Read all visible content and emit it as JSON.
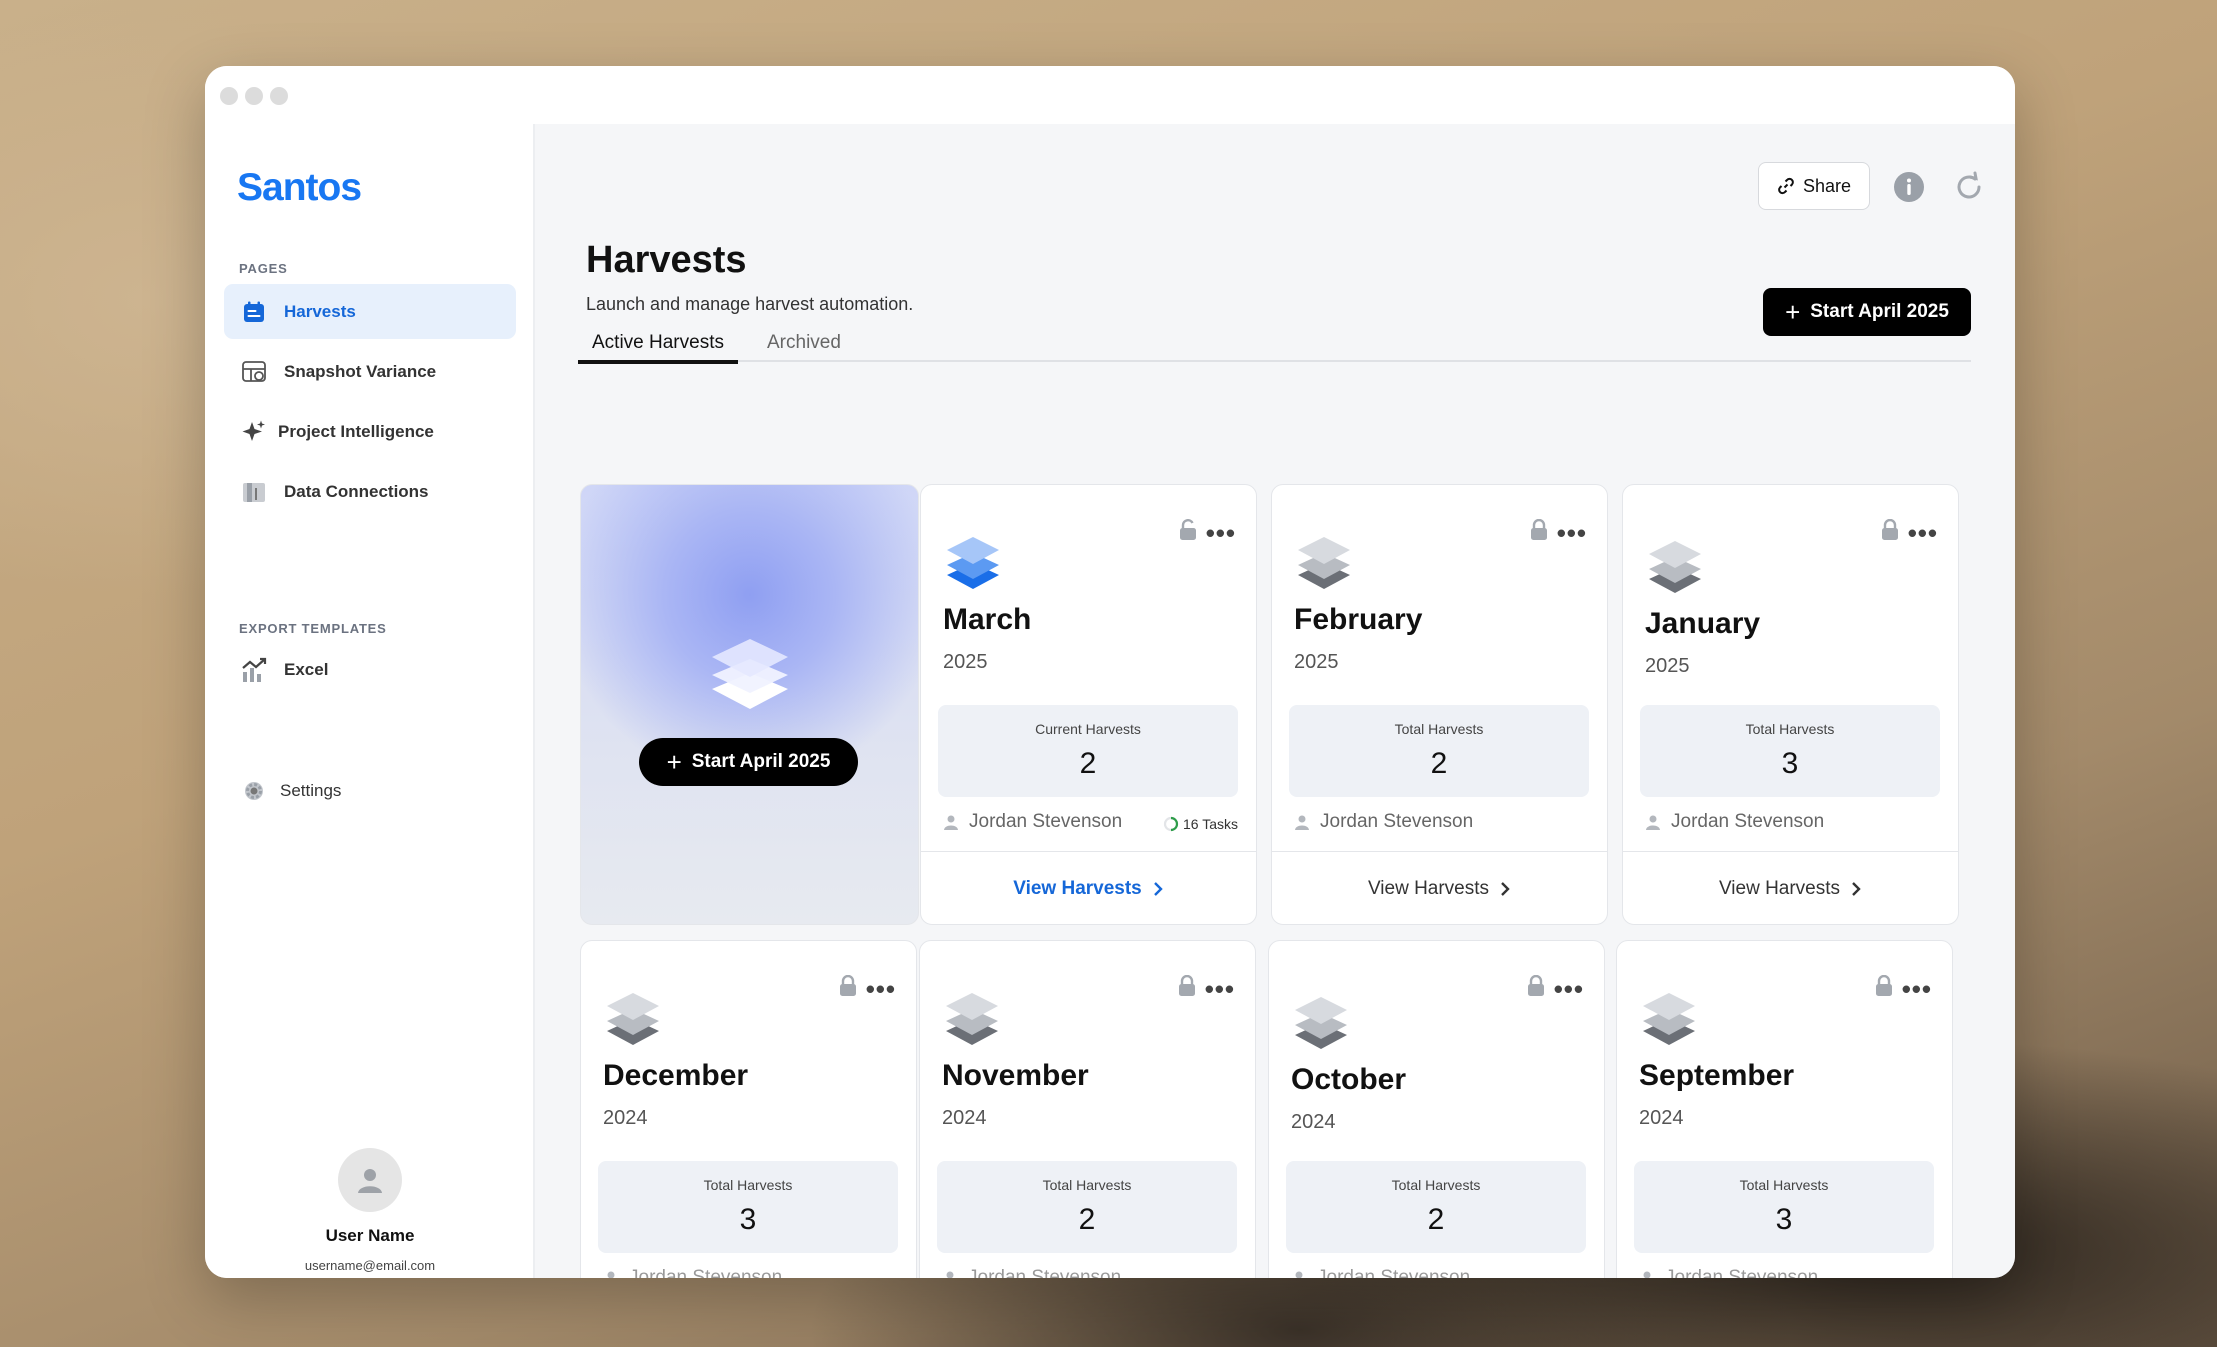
{
  "app": {
    "brand": "Santos"
  },
  "sidebar": {
    "pages_heading": "PAGES",
    "items": [
      {
        "label": "Harvests",
        "icon": "calendar-icon",
        "active": true
      },
      {
        "label": "Snapshot Variance",
        "icon": "snapshot-icon"
      },
      {
        "label": "Project Intelligence",
        "icon": "sparkle-icon"
      },
      {
        "label": "Data Connections",
        "icon": "folder-icon"
      }
    ],
    "export_heading": "EXPORT TEMPLATES",
    "export_items": [
      {
        "label": "Excel",
        "icon": "chart-up-icon"
      }
    ],
    "settings_label": "Settings",
    "user": {
      "name": "User Name",
      "email": "username@email.com"
    }
  },
  "header": {
    "share_label": "Share",
    "title": "Harvests",
    "subtitle": "Launch and manage harvest automation.",
    "start_button": "Start April 2025",
    "tabs": [
      {
        "label": "Active Harvests",
        "active": true
      },
      {
        "label": "Archived",
        "active": false
      }
    ]
  },
  "hero": {
    "button_label": "Start April 2025"
  },
  "cards": [
    {
      "month": "March",
      "year": "2025",
      "stat_label": "Current Harvests",
      "stat_value": "2",
      "owner": "Jordan Stevenson",
      "tasks": "16 Tasks",
      "action": "View Harvests",
      "active": true
    },
    {
      "month": "February",
      "year": "2025",
      "stat_label": "Total Harvests",
      "stat_value": "2",
      "owner": "Jordan Stevenson",
      "action": "View Harvests"
    },
    {
      "month": "January",
      "year": "2025",
      "stat_label": "Total Harvests",
      "stat_value": "3",
      "owner": "Jordan Stevenson",
      "action": "View Harvests"
    },
    {
      "month": "December",
      "year": "2024",
      "stat_label": "Total Harvests",
      "stat_value": "3",
      "owner": "Jordan Stevenson"
    },
    {
      "month": "November",
      "year": "2024",
      "stat_label": "Total Harvests",
      "stat_value": "2",
      "owner": "Jordan Stevenson"
    },
    {
      "month": "October",
      "year": "2024",
      "stat_label": "Total Harvests",
      "stat_value": "2",
      "owner": "Jordan Stevenson"
    },
    {
      "month": "September",
      "year": "2024",
      "stat_label": "Total Harvests",
      "stat_value": "3",
      "owner": "Jordan Stevenson"
    }
  ],
  "colors": {
    "accent": "#1567d8",
    "brand": "#1877f2"
  }
}
